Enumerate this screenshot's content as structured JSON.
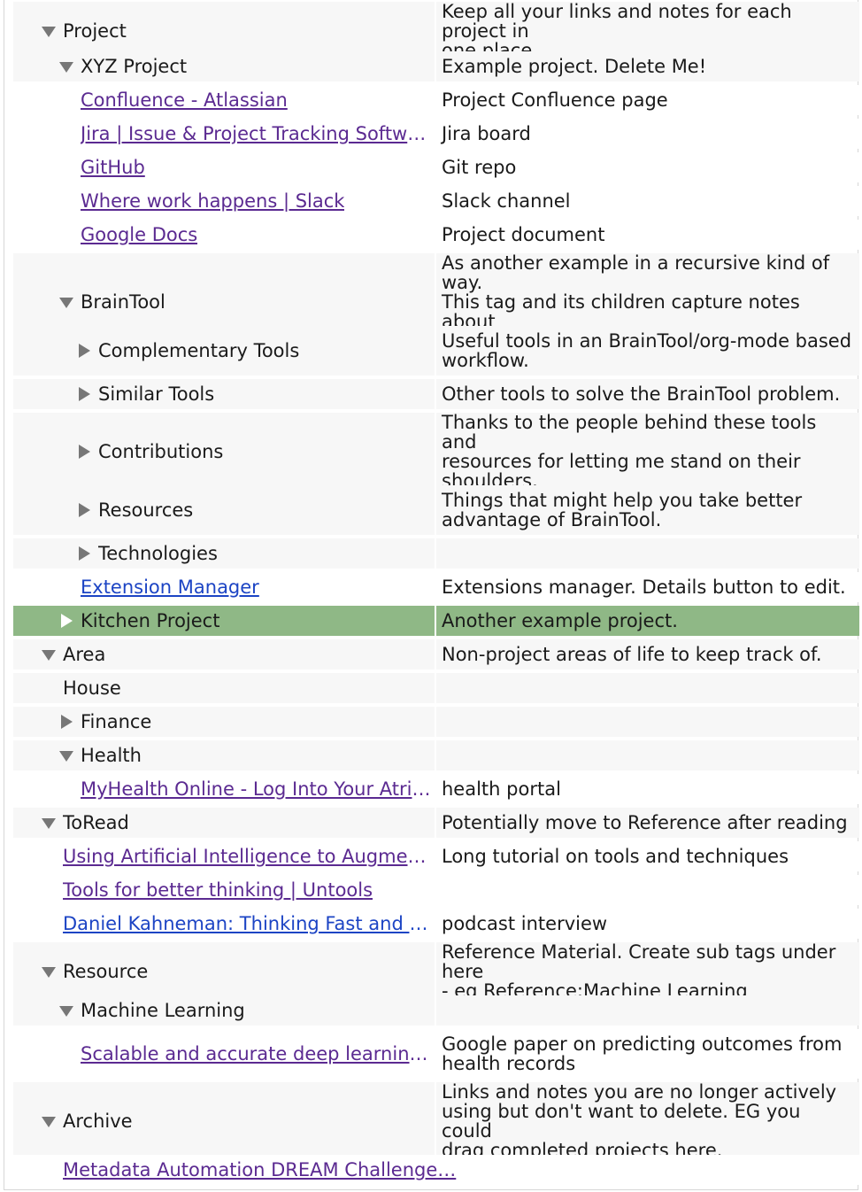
{
  "rows": [
    {
      "title": "Project",
      "note": "Keep all your links and notes for each project in\none place."
    },
    {
      "title": "XYZ Project",
      "note": "Example project. Delete Me!"
    },
    {
      "title": "Confluence - Atlassian",
      "note": "Project Confluence page"
    },
    {
      "title": "Jira | Issue & Project Tracking Softwar…",
      "note": "Jira board"
    },
    {
      "title": "GitHub",
      "note": "Git repo"
    },
    {
      "title": "Where work happens | Slack",
      "note": "Slack channel"
    },
    {
      "title": "Google Docs",
      "note": "Project document"
    },
    {
      "title": "BrainTool",
      "note": "As another example in a recursive kind of way.\nThis tag and its children capture notes about\nBrainTool."
    },
    {
      "title": "Complementary Tools",
      "note": "Useful tools in an BrainTool/org-mode based\nworkflow."
    },
    {
      "title": "Similar Tools",
      "note": "Other tools to solve the BrainTool problem."
    },
    {
      "title": "Contributions",
      "note": "Thanks to the people behind these tools and\nresources for letting me stand on their\nshoulders."
    },
    {
      "title": "Resources",
      "note": "Things that might help you take better\nadvantage of BrainTool."
    },
    {
      "title": "Technologies",
      "note": ""
    },
    {
      "title": "Extension Manager",
      "note": "Extensions manager. Details button to edit."
    },
    {
      "title": "Kitchen Project",
      "note": "Another example project."
    },
    {
      "title": "Area",
      "note": "Non-project areas of life to keep track of."
    },
    {
      "title": "House",
      "note": ""
    },
    {
      "title": "Finance",
      "note": ""
    },
    {
      "title": "Health",
      "note": ""
    },
    {
      "title": "MyHealth Online - Log Into Your Atriu…",
      "note": "health portal"
    },
    {
      "title": "ToRead",
      "note": "Potentially move to Reference after reading"
    },
    {
      "title": "Using Artificial Intelligence to Augment …",
      "note": "Long tutorial on tools and techniques"
    },
    {
      "title": "Tools for better thinking | Untools",
      "note": ""
    },
    {
      "title": "Daniel Kahneman: Thinking Fast and Sl…",
      "note": "podcast interview"
    },
    {
      "title": "Resource",
      "note": "Reference Material. Create sub tags under here\n- eg Reference:Machine Learning"
    },
    {
      "title": "Machine Learning",
      "note": ""
    },
    {
      "title": "Scalable and accurate deep learning …",
      "note": "Google paper on predicting outcomes from\nhealth records"
    },
    {
      "title": "Archive",
      "note": "Links and notes you are no longer actively\nusing but don't want to delete. EG you could\ndrag completed projects here."
    },
    {
      "title": "Metadata Automation DREAM Challenge…",
      "note": ""
    }
  ],
  "colors": {
    "selected_row": "#8fb886",
    "tag_row": "#f7f7f7",
    "visited_link": "#5b2a91",
    "unvisited_link": "#1c44c4",
    "twisty": "#777777"
  },
  "icons": {
    "expanded": "triangle-down-icon",
    "collapsed": "triangle-right-icon"
  }
}
